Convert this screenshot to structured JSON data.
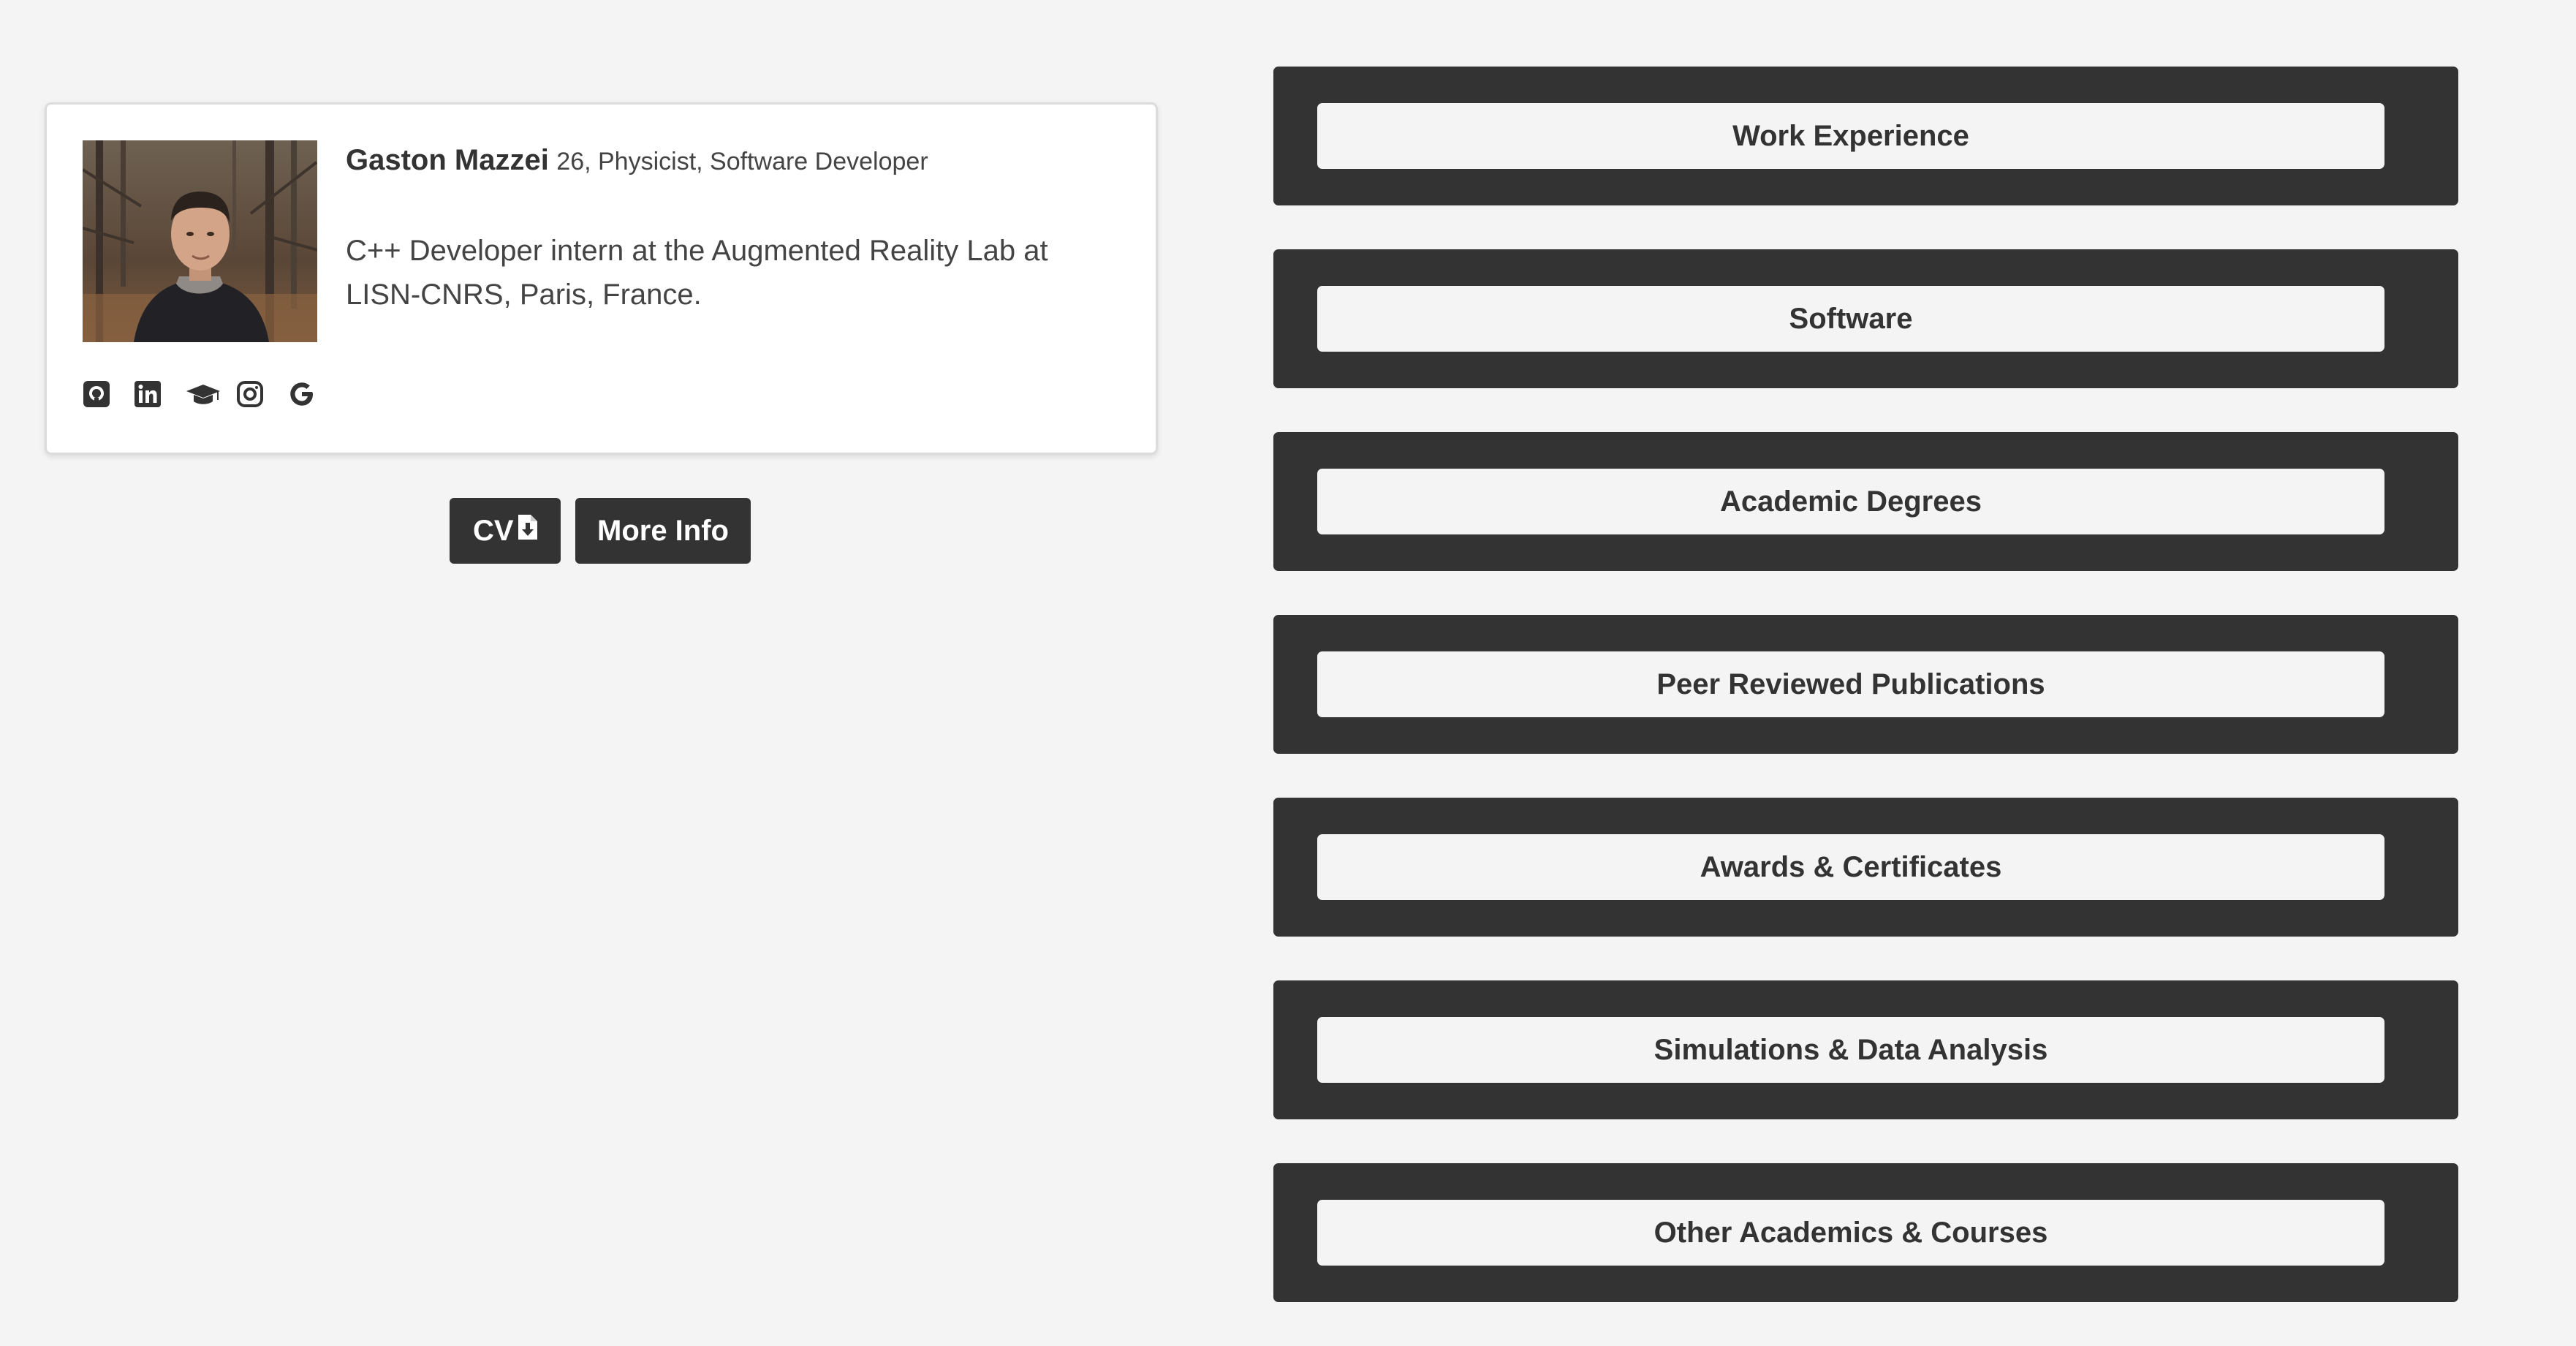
{
  "profile": {
    "name": "Gaston Mazzei",
    "tagline": "26, Physicist, Software Developer",
    "bio": "C++ Developer intern at the Augmented Reality Lab at LISN-CNRS, Paris, France.",
    "avatar_alt": "Portrait photo",
    "social_links": [
      {
        "icon": "github-icon"
      },
      {
        "icon": "linkedin-icon"
      },
      {
        "icon": "graduation-cap-icon"
      },
      {
        "icon": "instagram-icon"
      },
      {
        "icon": "google-icon"
      }
    ]
  },
  "actions": {
    "cv_label": "CV",
    "cv_icon": "file-download-icon",
    "more_info_label": "More Info"
  },
  "sections": [
    {
      "label": "Work Experience"
    },
    {
      "label": "Software"
    },
    {
      "label": "Academic Degrees"
    },
    {
      "label": "Peer Reviewed Publications"
    },
    {
      "label": "Awards & Certificates"
    },
    {
      "label": "Simulations & Data Analysis"
    },
    {
      "label": "Other Academics & Courses"
    }
  ],
  "colors": {
    "background": "#f4f4f4",
    "dark": "#333333",
    "card": "#ffffff",
    "text": "#333333"
  }
}
